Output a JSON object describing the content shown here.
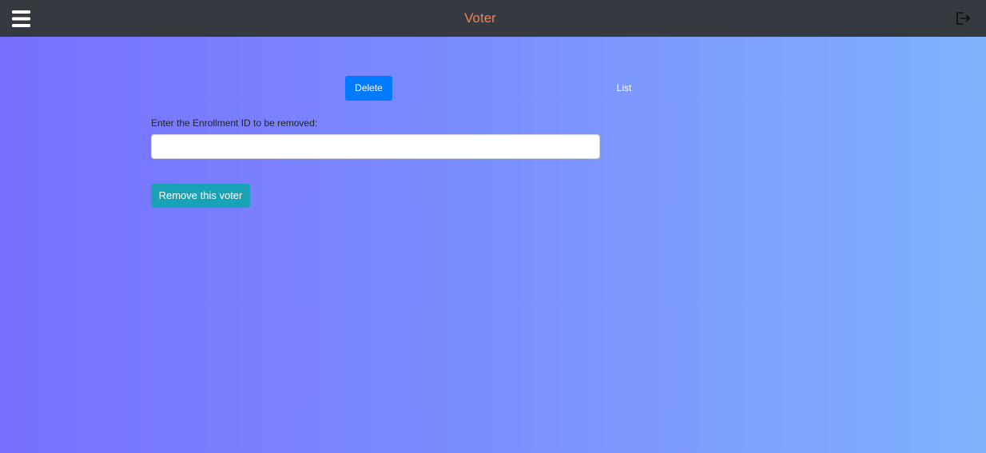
{
  "header": {
    "menu_icon": "hamburger-menu-icon",
    "title": "Voter",
    "logout_icon": "logout-icon",
    "title_color": "#ff7f50",
    "background_color": "#343a40"
  },
  "tabs": [
    {
      "label": "Delete",
      "active": true
    },
    {
      "label": "List",
      "active": false
    }
  ],
  "form": {
    "label": "Enter the Enrollment ID to be removed:",
    "input_value": "",
    "input_placeholder": "",
    "submit_label": "Remove this voter"
  },
  "colors": {
    "active_tab": "#007bff",
    "submit_button": "#17a2b8",
    "gradient_start": "#7770fe",
    "gradient_end": "#7fb2fd"
  }
}
